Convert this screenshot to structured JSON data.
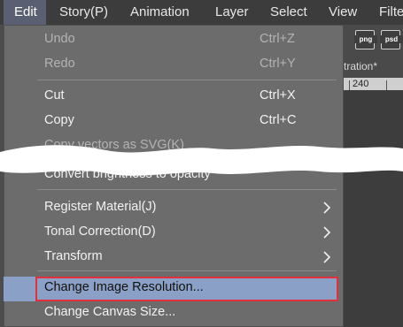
{
  "menubar": {
    "items": [
      "Edit",
      "Story(P)",
      "Animation",
      "Layer",
      "Select",
      "View",
      "Filte"
    ]
  },
  "toolbar": {
    "icon1_label": "png",
    "icon2_label": "psd"
  },
  "document": {
    "tab_title": "tration*",
    "ruler_label": "240"
  },
  "edit_menu": {
    "undo": {
      "label": "Undo",
      "shortcut": "Ctrl+Z"
    },
    "redo": {
      "label": "Redo",
      "shortcut": "Ctrl+Y"
    },
    "cut": {
      "label": "Cut",
      "shortcut": "Ctrl+X"
    },
    "copy": {
      "label": "Copy",
      "shortcut": "Ctrl+C"
    },
    "copy_svg": {
      "label": "Copy vectors as SVG(K)"
    },
    "convert": {
      "label": "Convert brightness to opacity"
    },
    "register_material": {
      "label": "Register Material(J)"
    },
    "tonal_correction": {
      "label": "Tonal Correction(D)"
    },
    "transform": {
      "label": "Transform"
    },
    "change_resolution": {
      "label": "Change Image Resolution..."
    },
    "change_canvas": {
      "label": "Change Canvas Size..."
    }
  },
  "colors": {
    "highlight": "#8ba0c6",
    "annotation_border": "#e0313c",
    "menu_bg": "#6c6c6c"
  }
}
